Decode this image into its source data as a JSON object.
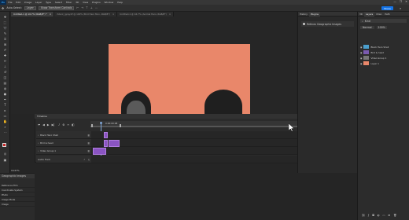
{
  "menubar": {
    "logo": "Ps",
    "items": [
      "File",
      "Edit",
      "Image",
      "Layer",
      "Type",
      "Select",
      "Filter",
      "3D",
      "View",
      "Plugins",
      "Window",
      "Help"
    ],
    "window_controls": [
      "—",
      "❐",
      "✕"
    ]
  },
  "options": {
    "auto_select": "Auto-Select:",
    "layer": "Layer",
    "transform": "Show Transform Controls"
  },
  "share_label": "Share",
  "tabs": [
    {
      "title": "Untitled-1 @ 16.7% (RGB/8*) *",
      "close": "×"
    },
    {
      "title": "iStock_lgray.tif @ 100% (Bird Hero Mon, RGB/8*)",
      "close": "×"
    },
    {
      "title": "Untitled-1 @ 16.7% (Animal Hero, RGB/8*)",
      "close": "×"
    }
  ],
  "dock_a": {
    "tab_history": "History",
    "tab_plugins": "Plugins",
    "plugin_name": "Retinex Geographic Images",
    "plugin_icon": "plugin-icon"
  },
  "dock_b": {
    "tabs": [
      "3D",
      "Layers",
      "Chan",
      "Path"
    ],
    "search_placeholder": "Kind",
    "blend": "Normal",
    "opacity": "100%",
    "layers": [
      {
        "name": "Black Hero Shell",
        "thumb": "#4a9ecc"
      },
      {
        "name": "Bird & head",
        "thumb": "#7a5ab0"
      },
      {
        "name": "Video Group 1",
        "thumb": "#777777"
      },
      {
        "name": "Layer 1",
        "thumb": "#e9876a"
      }
    ]
  },
  "timeline": {
    "title": "Timeline",
    "time": "0:00:00:08",
    "rows": [
      {
        "name": "Black Hero Shell"
      },
      {
        "name": "Bird & head"
      },
      {
        "name": "Video Group 1"
      },
      {
        "name": "Audio Track"
      }
    ]
  },
  "left_panel": {
    "tab": "Geographic Images",
    "items": [
      "Reference Film",
      "Coordinate System",
      "Photo",
      "Image Mode",
      "Image"
    ],
    "zoom": "16.67%"
  },
  "colors": {
    "accent": "#1473e6",
    "clip": "#8a54c2",
    "artwork": "#e9876a",
    "fg_swatch": "#c62828"
  }
}
